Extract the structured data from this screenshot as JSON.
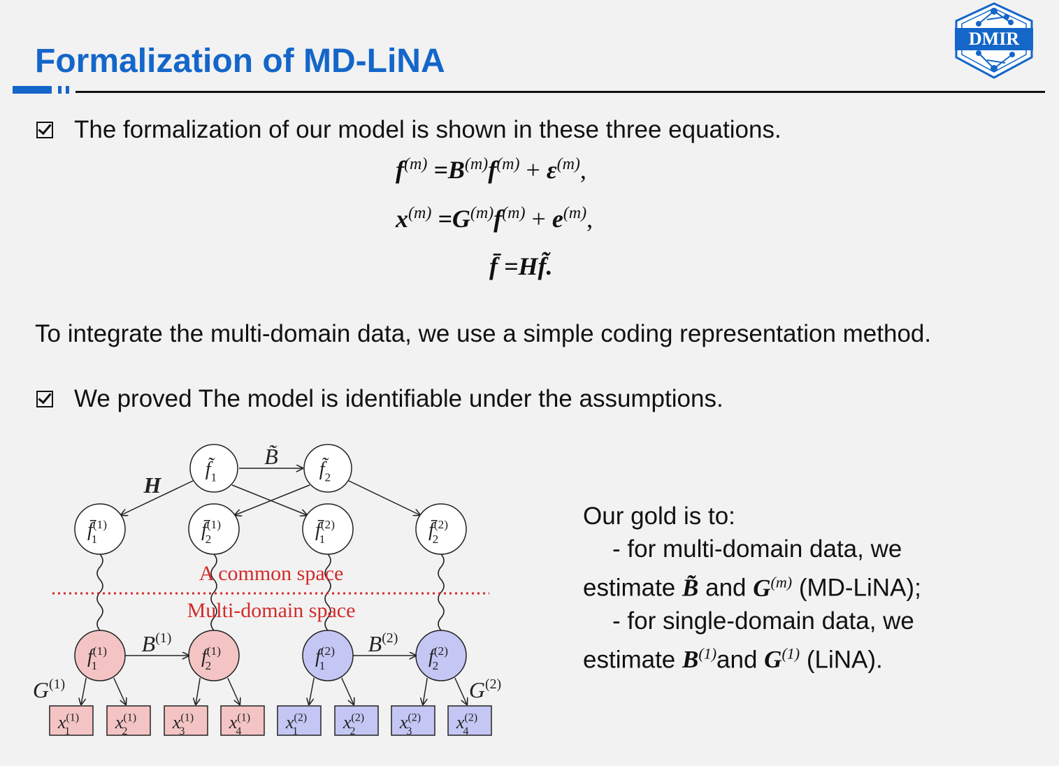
{
  "slide": {
    "title": "Formalization of MD-LiNA",
    "logo_text": "DMIR"
  },
  "bullets": [
    {
      "text": "The formalization of our model is shown in these three equations."
    },
    {
      "text": "We proved The model is identifiable under the assumptions."
    }
  ],
  "equations": {
    "eq1": {
      "lhs": "f",
      "sup": "(m)",
      "rhs1": "=B",
      "rhs2": "f",
      "plus": "+",
      "noise": "ε",
      "end": ","
    },
    "eq2": {
      "lhs": "x",
      "sup": "(m)",
      "rhs1": "=G",
      "rhs2": "f",
      "plus": "+",
      "noise": "e",
      "end": ","
    },
    "eq3": {
      "text": "f̄ =Hf̃."
    }
  },
  "paragraph": "To integrate the multi-domain data, we use a simple coding representation method.",
  "goal": {
    "l1": "Our gold is to:",
    "l2": "- for multi-domain data, we",
    "l3_pre": "estimate",
    "l3_b": "B̃",
    "l3_mid": "and",
    "l3_g": "G",
    "l3_sup": "(m)",
    "l3_post": "(MD-LiNA);",
    "l4": "- for single-domain data, we",
    "l5_pre": "estimate",
    "l5_b": "B",
    "l5_bsup": "(1)",
    "l5_mid": "and",
    "l5_g": "G",
    "l5_gsup": "(1)",
    "l5_post": "(LiNA)."
  },
  "diagram": {
    "top_nodes": [
      {
        "base": "f̃",
        "sub": "1"
      },
      {
        "base": "f̃",
        "sub": "2"
      }
    ],
    "top_edge_label": "B̃",
    "H_label": "H",
    "mid_nodes": [
      {
        "base": "f̄",
        "sub": "1",
        "sup": "(1)"
      },
      {
        "base": "f̄",
        "sub": "2",
        "sup": "(1)"
      },
      {
        "base": "f̄",
        "sub": "1",
        "sup": "(2)"
      },
      {
        "base": "f̄",
        "sub": "2",
        "sup": "(2)"
      }
    ],
    "common_space": "A common space",
    "multi_domain_space": "Multi-domain space",
    "bottom_nodes": [
      {
        "base": "f",
        "sub": "1",
        "sup": "(1)"
      },
      {
        "base": "f",
        "sub": "2",
        "sup": "(1)"
      },
      {
        "base": "f",
        "sub": "1",
        "sup": "(2)"
      },
      {
        "base": "f",
        "sub": "2",
        "sup": "(2)"
      }
    ],
    "b1_label": "B",
    "b1_sup": "(1)",
    "b2_label": "B",
    "b2_sup": "(2)",
    "g1_label": "G",
    "g1_sup": "(1)",
    "g2_label": "G",
    "g2_sup": "(2)",
    "observed": [
      {
        "base": "x",
        "sub": "1",
        "sup": "(1)"
      },
      {
        "base": "x",
        "sub": "2",
        "sup": "(1)"
      },
      {
        "base": "x",
        "sub": "3",
        "sup": "(1)"
      },
      {
        "base": "x",
        "sub": "4",
        "sup": "(1)"
      },
      {
        "base": "x",
        "sub": "1",
        "sup": "(2)"
      },
      {
        "base": "x",
        "sub": "2",
        "sup": "(2)"
      },
      {
        "base": "x",
        "sub": "3",
        "sup": "(2)"
      },
      {
        "base": "x",
        "sub": "4",
        "sup": "(2)"
      }
    ],
    "colors": {
      "red_fill": "#f4c4c4",
      "blue_fill": "#c4c6f4",
      "space_color": "#d42a2a"
    }
  }
}
